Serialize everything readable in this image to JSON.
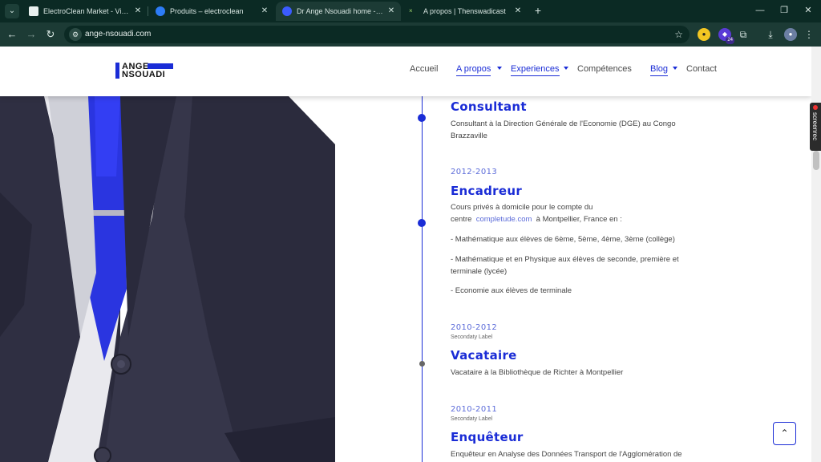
{
  "browser": {
    "tabs": [
      {
        "title": "ElectroClean Market - Vision M",
        "favicon_color": "#e8f0ee",
        "active": false
      },
      {
        "title": "Produits – electroclean",
        "favicon_color": "#2d7cf6",
        "active": false
      },
      {
        "title": "Dr Ange Nsouadi home - Ange",
        "favicon_color": "#3b5bff",
        "active": true
      },
      {
        "title": "A propos | Thenswadicast",
        "favicon_color": "#1c3b35",
        "active": false
      }
    ],
    "url": "ange-nsouadi.com",
    "extension_badge": "24"
  },
  "site": {
    "logo_line1": "ANGE",
    "logo_line2": "NSOUADI",
    "nav": [
      {
        "label": "Accueil"
      },
      {
        "label": "A propos"
      },
      {
        "label": "Experiences"
      },
      {
        "label": "Compétences"
      },
      {
        "label": "Blog"
      },
      {
        "label": "Contact"
      }
    ]
  },
  "timeline": [
    {
      "title": "Consultant",
      "text": "Consultant à la Direction Générale de l'Economie (DGE) au Congo Brazzaville"
    },
    {
      "date": "2012-2013",
      "title": "Encadreur",
      "line1": "Cours privés à domicile pour le compte du",
      "line2_pre": "centre",
      "line2_link": "completude.com",
      "line2_post": "à Montpellier, France en :",
      "bullets": [
        "- Mathématique aux élèves de 6ème, 5ème, 4ème, 3ème (collège)",
        "- Mathématique et en Physique aux élèves de seconde, première et terminale (lycée)",
        "- Economie aux élèves de terminale"
      ]
    },
    {
      "date": "2010-2012",
      "sublabel": "Secondaty Label",
      "title": "Vacataire",
      "text": "Vacataire à la Bibliothèque de Richter à Montpellier"
    },
    {
      "date": "2010-2011",
      "sublabel": "Secondaty Label",
      "title": "Enquêteur",
      "text": "Enquêteur en Analyse des Données Transport de l'Agglomération de"
    }
  ],
  "screenrec_label": "screenrec",
  "colors": {
    "accent": "#1a2cd6",
    "chrome_dark": "#0b2a24",
    "chrome": "#1c3b35"
  }
}
